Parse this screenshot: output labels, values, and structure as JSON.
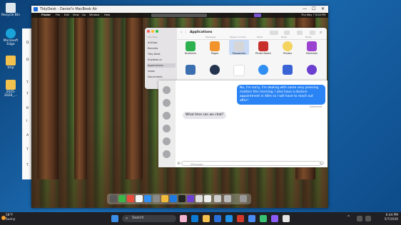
{
  "desktop": {
    "icons": [
      {
        "label": "Recycle Bin",
        "icon": "recycle-bin-icon",
        "color": "#dfe7ee"
      },
      {
        "label": "Microsoft Edge",
        "icon": "edge-icon",
        "color": "#1aa3d9"
      },
      {
        "label": "tmp",
        "icon": "folder-icon",
        "color": "#f2c14e"
      },
      {
        "label": "2025-2026_...",
        "icon": "folder-icon",
        "color": "#f2c14e"
      }
    ]
  },
  "remote_window": {
    "title": "TidyDesk - Daniel's MacBook Air",
    "controls": [
      "—",
      "☐",
      "✕"
    ]
  },
  "mac_menubar": {
    "apple": "",
    "app": "Finder",
    "items": [
      "File",
      "Edit",
      "View",
      "Go",
      "Window",
      "Help"
    ],
    "datetime": "Thu May 7 6:44 PM"
  },
  "finder": {
    "title": "Applications",
    "sidebar_header": "Favorites",
    "sidebar": [
      "AirDrop",
      "Recents",
      "Tidy Desk",
      "tidydesk.ai",
      "Applications",
      "repos",
      "Documents"
    ],
    "selected": "Applications",
    "top_row_labels": [
      "",
      "Messages",
      "Mission Control",
      "Music",
      "News",
      "Notes"
    ],
    "apps_row1": [
      {
        "label": "Numbers",
        "icon": "numbers-icon",
        "color": "#2db14e"
      },
      {
        "label": "Pages",
        "icon": "pages-icon",
        "color": "#f2942e"
      },
      {
        "label": "Passwords",
        "icon": "passwords-icon",
        "color": "#d6d6d6"
      },
      {
        "label": "Photo Booth",
        "icon": "photo-booth-icon",
        "color": "#c8312a"
      },
      {
        "label": "Photos",
        "icon": "photos-icon",
        "color": "#f4d35e"
      },
      {
        "label": "Podcasts",
        "icon": "podcasts-icon",
        "color": "#9c42d1"
      }
    ],
    "apps_row2": [
      {
        "icon": "preview-icon",
        "color": "#3c6fb0"
      },
      {
        "icon": "quicktime-icon",
        "color": "#24344f"
      },
      {
        "icon": "reminders-icon",
        "color": "#ffffff"
      },
      {
        "icon": "safari-icon",
        "color": "#2f8ff3"
      },
      {
        "icon": "screen-sharing-icon",
        "color": "#3a63d6"
      },
      {
        "icon": "siri-icon",
        "color": "#6b3fd0"
      }
    ]
  },
  "messages": {
    "outgoing": "No, I'm sorry, I'm dealing with some very pressing matters this morning. I also have a doctors appointment in 40m so I will have to reach out after!",
    "status": "Delivered",
    "incoming": "What time can we chat?",
    "placeholder": "iMessage"
  },
  "sliver_letters": [
    "D",
    "D",
    "T",
    "T",
    "R",
    "I",
    "A",
    "T",
    "T"
  ],
  "taskbar": {
    "weather_temp": "58°F",
    "weather_desc": "Sunny",
    "search_placeholder": "Search",
    "time": "6:44 PM",
    "date": "5/7/2026"
  }
}
